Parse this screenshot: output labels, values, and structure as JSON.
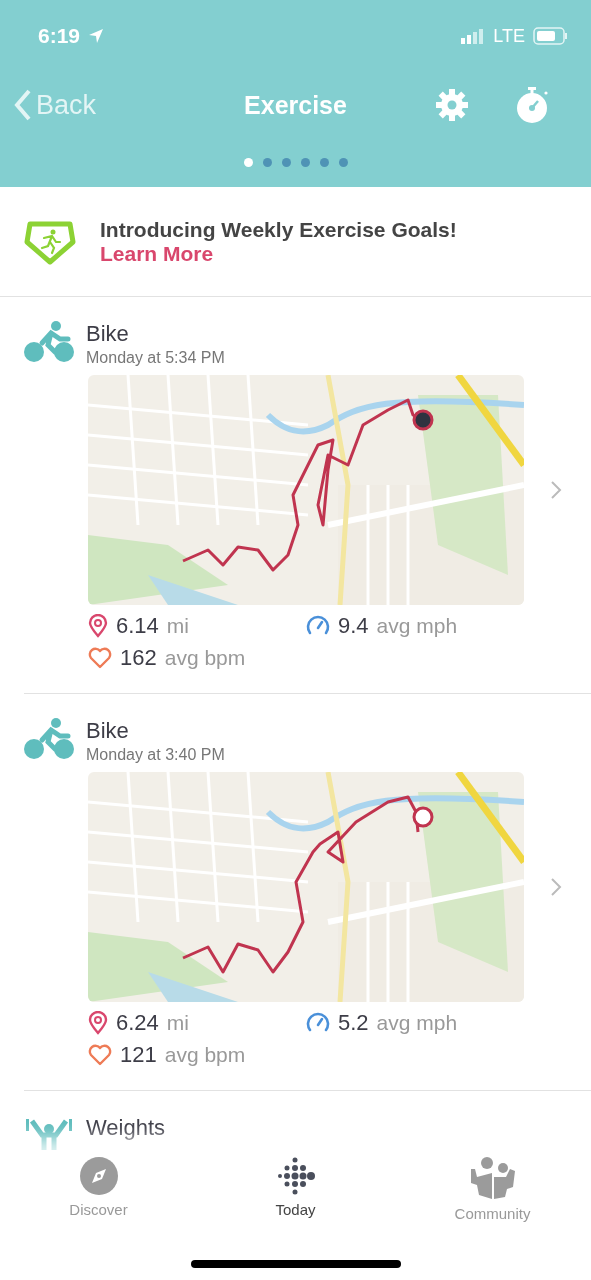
{
  "status_bar": {
    "time": "6:19",
    "network": "LTE"
  },
  "nav": {
    "back": "Back",
    "title": "Exercise"
  },
  "page_dots": [
    {
      "selected": true
    },
    {
      "selected": false
    },
    {
      "selected": false
    },
    {
      "selected": false
    },
    {
      "selected": false
    },
    {
      "selected": false
    }
  ],
  "banner": {
    "title": "Introducing Weekly Exercise Goals!",
    "link": "Learn More"
  },
  "activities": [
    {
      "kind": "bike",
      "name": "Bike",
      "time": "Monday at 5:34 PM",
      "stats": [
        {
          "kind": "distance",
          "value": "6.14",
          "unit": "mi"
        },
        {
          "kind": "speed",
          "value": "9.4",
          "unit": "avg mph"
        },
        {
          "kind": "heart",
          "value": "162",
          "unit": "avg bpm"
        }
      ]
    },
    {
      "kind": "bike",
      "name": "Bike",
      "time": "Monday at 3:40 PM",
      "stats": [
        {
          "kind": "distance",
          "value": "6.24",
          "unit": "mi"
        },
        {
          "kind": "speed",
          "value": "5.2",
          "unit": "avg mph"
        },
        {
          "kind": "heart",
          "value": "121",
          "unit": "avg bpm"
        }
      ]
    },
    {
      "kind": "weights",
      "name": "Weights"
    }
  ],
  "tab_bar": [
    {
      "kind": "discover",
      "label": "Discover",
      "selected": false
    },
    {
      "kind": "today",
      "label": "Today",
      "selected": true
    },
    {
      "kind": "community",
      "label": "Community",
      "selected": false
    }
  ]
}
